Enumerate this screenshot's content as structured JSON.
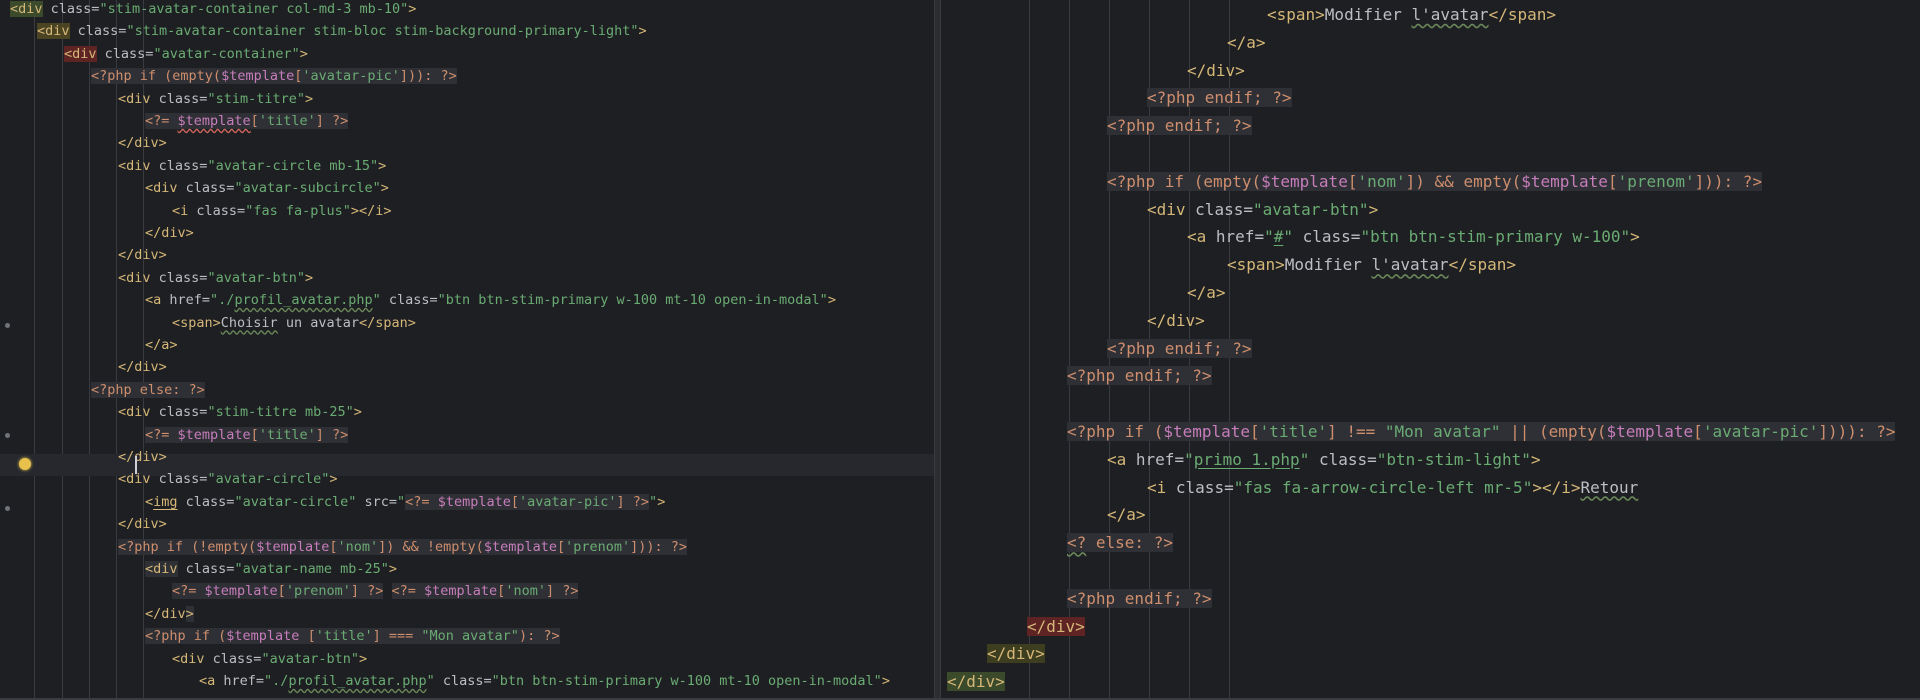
{
  "editor": {
    "left_lines": [
      {
        "indent": "",
        "html": "<span class=\"t-tag hl-green\">&lt;div</span> <span class=\"t-attr\">class=</span><span class=\"t-str\">\"stim-avatar-container col-md-3 mb-10\"</span><span class=\"t-tag\">&gt;</span>",
        "text": "<div class=\"stim-avatar-container col-md-3 mb-10\">"
      },
      {
        "indent": "    ",
        "html": "<span class=\"t-tag hl-yellow\">&lt;div</span> <span class=\"t-attr\">class=</span><span class=\"t-str\">\"stim-avatar-container stim-bloc stim-background-primary-light\"</span><span class=\"t-tag\">&gt;</span>",
        "text": "<div class=\"stim-avatar-container stim-bloc stim-background-primary-light\">"
      },
      {
        "indent": "        ",
        "html": "<span class=\"t-tag hl-red\">&lt;div</span> <span class=\"t-attr\">class=</span><span class=\"t-str\">\"avatar-container\"</span><span class=\"t-tag\">&gt;</span>",
        "text": "<div class=\"avatar-container\">"
      }
    ],
    "right_lines": []
  }
}
